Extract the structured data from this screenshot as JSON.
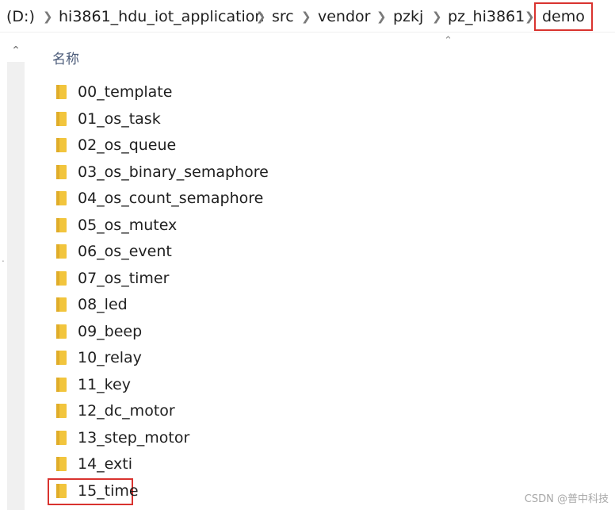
{
  "breadcrumb": [
    {
      "label": "(D:)"
    },
    {
      "label": "hi3861_hdu_iot_application"
    },
    {
      "label": "src"
    },
    {
      "label": "vendor"
    },
    {
      "label": "pzkj"
    },
    {
      "label": "pz_hi3861"
    },
    {
      "label": "demo",
      "highlighted": true
    }
  ],
  "column_header": {
    "name_label": "名称"
  },
  "folders": [
    {
      "name": "00_template"
    },
    {
      "name": "01_os_task"
    },
    {
      "name": "02_os_queue"
    },
    {
      "name": "03_os_binary_semaphore"
    },
    {
      "name": "04_os_count_semaphore"
    },
    {
      "name": "05_os_mutex"
    },
    {
      "name": "06_os_event"
    },
    {
      "name": "07_os_timer"
    },
    {
      "name": "08_led"
    },
    {
      "name": "09_beep"
    },
    {
      "name": "10_relay"
    },
    {
      "name": "11_key"
    },
    {
      "name": "12_dc_motor"
    },
    {
      "name": "13_step_motor"
    },
    {
      "name": "14_exti"
    },
    {
      "name": "15_time",
      "highlighted": true
    }
  ],
  "icons": {
    "chevron": "chevron-right-icon",
    "folder": "folder-icon",
    "scroll_up": "scroll-up-icon",
    "sort": "sort-ascending-icon"
  },
  "colors": {
    "highlight_box": "#d9332f",
    "folder_yellow": "#f2c53d",
    "header_text": "#4a5a78"
  },
  "watermark": "CSDN @普中科技"
}
